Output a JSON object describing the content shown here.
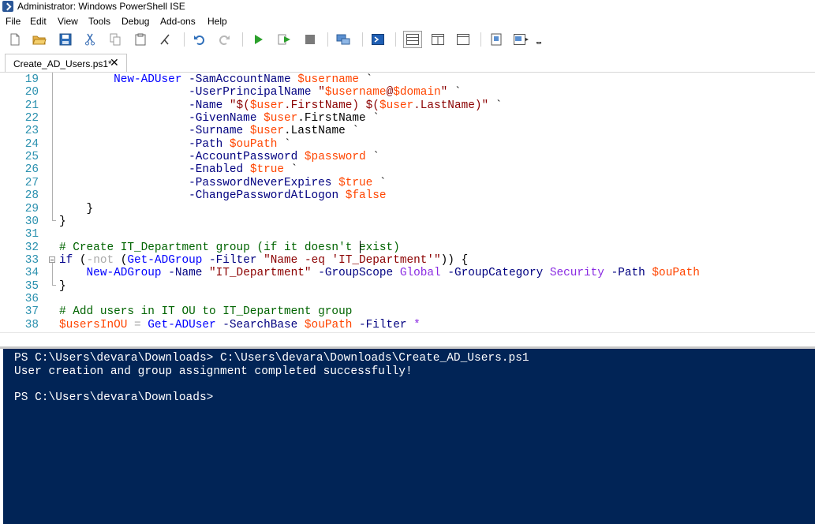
{
  "window": {
    "title": "Administrator: Windows PowerShell ISE"
  },
  "menu": {
    "items": [
      "File",
      "Edit",
      "View",
      "Tools",
      "Debug",
      "Add-ons",
      "Help"
    ]
  },
  "toolbar": {
    "buttons": [
      "new-icon",
      "open-icon",
      "save-icon",
      "cut-icon",
      "copy-icon",
      "paste-icon",
      "clear-icon",
      "undo-icon",
      "redo-icon",
      "run-icon",
      "run-selection-icon",
      "stop-icon",
      "remote-icon",
      "console-icon",
      "layout-top-icon",
      "layout-right-icon",
      "layout-max-icon",
      "script-pane-icon",
      "command-addon-icon",
      "overflow-icon"
    ]
  },
  "tab": {
    "label": "Create_AD_Users.ps1*",
    "close": "✕"
  },
  "editor": {
    "line_numbers": [
      "19",
      "20",
      "21",
      "22",
      "23",
      "24",
      "25",
      "26",
      "27",
      "28",
      "29",
      "30",
      "31",
      "32",
      "33",
      "34",
      "35",
      "36",
      "37",
      "38"
    ],
    "lines": [
      [
        [
          "plain",
          "        "
        ],
        [
          "cmd",
          "New-ADUser"
        ],
        [
          "plain",
          " "
        ],
        [
          "param",
          "-SamAccountName"
        ],
        [
          "plain",
          " "
        ],
        [
          "var",
          "$username"
        ],
        [
          "plain",
          " `"
        ]
      ],
      [
        [
          "plain",
          "                   "
        ],
        [
          "param",
          "-UserPrincipalName"
        ],
        [
          "plain",
          " "
        ],
        [
          "str",
          "\""
        ],
        [
          "var",
          "$username"
        ],
        [
          "str",
          "@"
        ],
        [
          "var",
          "$domain"
        ],
        [
          "str",
          "\""
        ],
        [
          "plain",
          " `"
        ]
      ],
      [
        [
          "plain",
          "                   "
        ],
        [
          "param",
          "-Name"
        ],
        [
          "plain",
          " "
        ],
        [
          "str",
          "\"$("
        ],
        [
          "var",
          "$user"
        ],
        [
          "str",
          ".FirstName) $("
        ],
        [
          "var",
          "$user"
        ],
        [
          "str",
          ".LastName)\""
        ],
        [
          "plain",
          " `"
        ]
      ],
      [
        [
          "plain",
          "                   "
        ],
        [
          "param",
          "-GivenName"
        ],
        [
          "plain",
          " "
        ],
        [
          "var",
          "$user"
        ],
        [
          "plain",
          ".FirstName `"
        ]
      ],
      [
        [
          "plain",
          "                   "
        ],
        [
          "param",
          "-Surname"
        ],
        [
          "plain",
          " "
        ],
        [
          "var",
          "$user"
        ],
        [
          "plain",
          ".LastName `"
        ]
      ],
      [
        [
          "plain",
          "                   "
        ],
        [
          "param",
          "-Path"
        ],
        [
          "plain",
          " "
        ],
        [
          "var",
          "$ouPath"
        ],
        [
          "plain",
          " `"
        ]
      ],
      [
        [
          "plain",
          "                   "
        ],
        [
          "param",
          "-AccountPassword"
        ],
        [
          "plain",
          " "
        ],
        [
          "var",
          "$password"
        ],
        [
          "plain",
          " `"
        ]
      ],
      [
        [
          "plain",
          "                   "
        ],
        [
          "param",
          "-Enabled"
        ],
        [
          "plain",
          " "
        ],
        [
          "var",
          "$true"
        ],
        [
          "plain",
          " `"
        ]
      ],
      [
        [
          "plain",
          "                   "
        ],
        [
          "param",
          "-PasswordNeverExpires"
        ],
        [
          "plain",
          " "
        ],
        [
          "var",
          "$true"
        ],
        [
          "plain",
          " `"
        ]
      ],
      [
        [
          "plain",
          "                   "
        ],
        [
          "param",
          "-ChangePasswordAtLogon"
        ],
        [
          "plain",
          " "
        ],
        [
          "var",
          "$false"
        ]
      ],
      [
        [
          "plain",
          "    }"
        ]
      ],
      [
        [
          "plain",
          "}"
        ]
      ],
      [
        [
          "plain",
          ""
        ]
      ],
      [
        [
          "com",
          "# Create IT_Department group (if it doesn't exist)"
        ]
      ],
      [
        [
          "kw",
          "if"
        ],
        [
          "plain",
          " ("
        ],
        [
          "op",
          "-not"
        ],
        [
          "plain",
          " ("
        ],
        [
          "cmd",
          "Get-ADGroup"
        ],
        [
          "plain",
          " "
        ],
        [
          "param",
          "-Filter"
        ],
        [
          "plain",
          " "
        ],
        [
          "str",
          "\"Name -eq 'IT_Department'\""
        ],
        [
          "plain",
          "))"
        ],
        [
          "plain",
          " {"
        ]
      ],
      [
        [
          "plain",
          "    "
        ],
        [
          "cmd",
          "New-ADGroup"
        ],
        [
          "plain",
          " "
        ],
        [
          "param",
          "-Name"
        ],
        [
          "plain",
          " "
        ],
        [
          "str",
          "\"IT_Department\""
        ],
        [
          "plain",
          " "
        ],
        [
          "param",
          "-GroupScope"
        ],
        [
          "plain",
          " "
        ],
        [
          "arg",
          "Global"
        ],
        [
          "plain",
          " "
        ],
        [
          "param",
          "-GroupCategory"
        ],
        [
          "plain",
          " "
        ],
        [
          "arg",
          "Security"
        ],
        [
          "plain",
          " "
        ],
        [
          "param",
          "-Path"
        ],
        [
          "plain",
          " "
        ],
        [
          "var",
          "$ouPath"
        ]
      ],
      [
        [
          "plain",
          "}"
        ]
      ],
      [
        [
          "plain",
          ""
        ]
      ],
      [
        [
          "com",
          "# Add users in IT OU to IT_Department group"
        ]
      ],
      [
        [
          "var",
          "$usersInOU"
        ],
        [
          "plain",
          " "
        ],
        [
          "op",
          "="
        ],
        [
          "plain",
          " "
        ],
        [
          "cmd",
          "Get-ADUser"
        ],
        [
          "plain",
          " "
        ],
        [
          "param",
          "-SearchBase"
        ],
        [
          "plain",
          " "
        ],
        [
          "var",
          "$ouPath"
        ],
        [
          "plain",
          " "
        ],
        [
          "param",
          "-Filter"
        ],
        [
          "plain",
          " "
        ],
        [
          "arg",
          "*"
        ]
      ]
    ]
  },
  "console": {
    "lines": [
      "PS C:\\Users\\devara\\Downloads> C:\\Users\\devara\\Downloads\\Create_AD_Users.ps1",
      "User creation and group assignment completed successfully!",
      "",
      "PS C:\\Users\\devara\\Downloads>"
    ]
  },
  "colors": {
    "console_bg": "#012456",
    "line_number": "#2b91af",
    "keyword": "#00008b",
    "command": "#0000ff",
    "parameter": "#000080",
    "variable": "#ff4500",
    "string": "#8b0000",
    "comment": "#006400"
  }
}
